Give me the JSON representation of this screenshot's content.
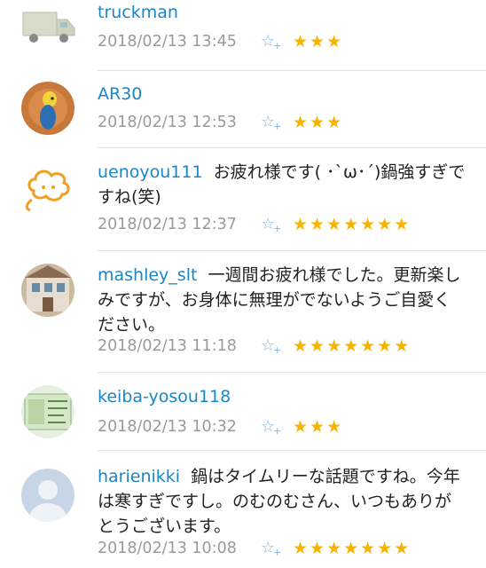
{
  "comments": [
    {
      "user": "truckman",
      "text": "",
      "time": "2018/02/13 13:45",
      "add_star": "☆",
      "add_plus": "+",
      "stars": "★★★",
      "star_count": 3,
      "avatar": "truck-avatar"
    },
    {
      "user": "AR30",
      "text": "",
      "time": "2018/02/13 12:53",
      "add_star": "☆",
      "add_plus": "+",
      "stars": "★★★",
      "star_count": 3,
      "avatar": "bird-avatar"
    },
    {
      "user": "uenoyou111",
      "text": "お疲れ様です( ･`ω･´)鍋強すぎですね(笑)",
      "time": "2018/02/13 12:37",
      "add_star": "☆",
      "add_plus": "+",
      "stars": "★★★★★★★",
      "star_count": 7,
      "avatar": "cloud-avatar"
    },
    {
      "user": "mashley_slt",
      "text": "一週間お疲れ様でした。更新楽しみですが、お身体に無理がでないようご自愛ください。",
      "time": "2018/02/13 11:18",
      "add_star": "☆",
      "add_plus": "+",
      "stars": "★★★★★★★",
      "star_count": 7,
      "avatar": "house-avatar"
    },
    {
      "user": "keiba-yosou118",
      "text": "",
      "time": "2018/02/13 10:32",
      "add_star": "☆",
      "add_plus": "+",
      "stars": "★★★",
      "star_count": 3,
      "avatar": "ticket-avatar"
    },
    {
      "user": "harienikki",
      "text": "鍋はタイムリーな話題ですね。今年は寒すぎですし。のむのむさん、いつもありがとうございます。",
      "time": "2018/02/13 10:08",
      "add_star": "☆",
      "add_plus": "+",
      "stars": "★★★★★★★",
      "star_count": 7,
      "avatar": "default-user-avatar"
    }
  ]
}
